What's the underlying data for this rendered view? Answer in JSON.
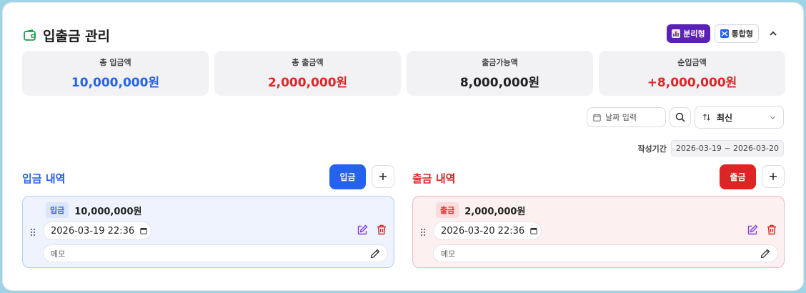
{
  "header": {
    "title": "입출금 관리",
    "split_label": "분리형",
    "merge_label": "통합형"
  },
  "stats": [
    {
      "label": "총 입금액",
      "value": "10,000,000원",
      "color": "#2563eb"
    },
    {
      "label": "총 출금액",
      "value": "2,000,000원",
      "color": "#dc2626"
    },
    {
      "label": "출금가능액",
      "value": "8,000,000원",
      "color": "#222222"
    },
    {
      "label": "순입금액",
      "value": "+8,000,000원",
      "color": "#dc2626"
    }
  ],
  "filters": {
    "date_placeholder": "날짜 입력",
    "sort_value": "최신",
    "period_label": "작성기간",
    "period_value": "2026-03-19 ~ 2026-03-20"
  },
  "deposit": {
    "title": "입금 내역",
    "action_label": "입금",
    "entries": [
      {
        "tag": "입금",
        "amount": "10,000,000원",
        "datetime": "2026-03-19 22:36",
        "memo_placeholder": "메모"
      }
    ]
  },
  "withdraw": {
    "title": "출금 내역",
    "action_label": "출금",
    "entries": [
      {
        "tag": "출금",
        "amount": "2,000,000원",
        "datetime": "2026-03-20 22:36",
        "memo_placeholder": "메모"
      }
    ]
  },
  "colors": {
    "primary_blue": "#2563eb",
    "danger_red": "#dc2626",
    "accent_purple": "#5b21b6"
  },
  "icons": [
    "wallet-icon",
    "bar-chart-icon",
    "shuffle-icon",
    "chevron-up-icon",
    "calendar-icon",
    "search-icon",
    "sort-icon",
    "chevron-down-icon",
    "plus-icon",
    "grip-icon",
    "edit-icon",
    "trash-icon",
    "pencil-icon"
  ]
}
